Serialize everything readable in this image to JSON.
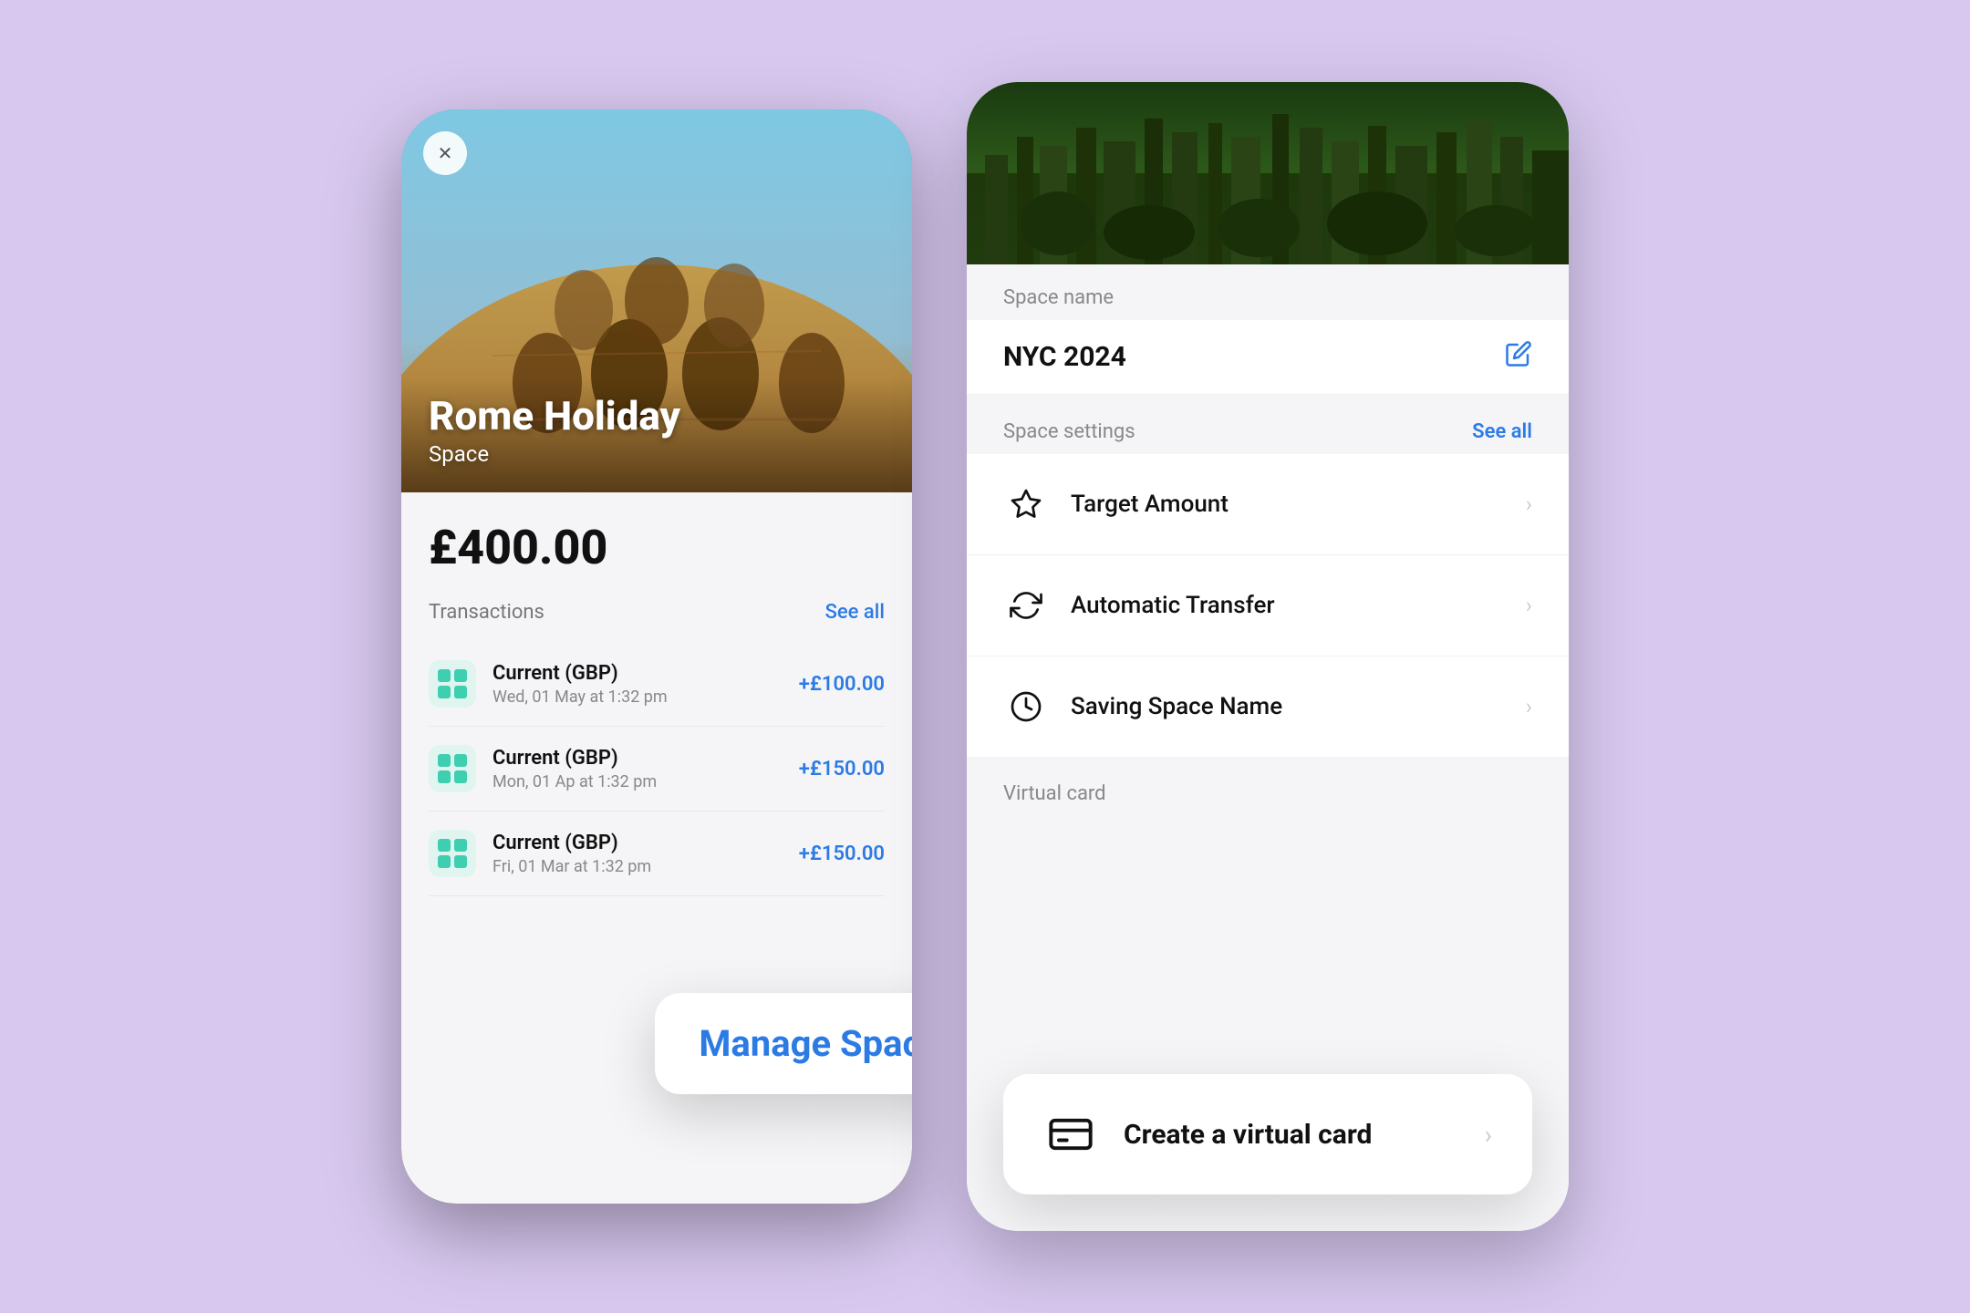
{
  "background_color": "#d8c8f0",
  "left_phone": {
    "hero": {
      "title": "Rome Holiday",
      "subtitle": "Space",
      "close_button": "×"
    },
    "balance": "£400.00",
    "transactions_label": "Transactions",
    "see_all_label": "See all",
    "transactions": [
      {
        "name": "Current (GBP)",
        "date": "Wed, 01 May at 1:32 pm",
        "amount": "+£100.00"
      },
      {
        "name": "Current (GBP)",
        "date": "Mon, 01 Ap at 1:32 pm",
        "amount": "+£150.00"
      },
      {
        "name": "Current (GBP)",
        "date": "Fri, 01 Mar at 1:32 pm",
        "amount": "+£150.00"
      }
    ],
    "manage_space_label": "Manage Space"
  },
  "right_panel": {
    "space_name_label": "Space name",
    "space_name_value": "NYC 2024",
    "settings_label": "Space settings",
    "settings_see_all": "See all",
    "settings_items": [
      {
        "icon": "star",
        "label": "Target Amount"
      },
      {
        "icon": "refresh",
        "label": "Automatic Transfer"
      },
      {
        "icon": "tag",
        "label": "Saving Space Name"
      }
    ],
    "virtual_card_label": "Virtual card",
    "virtual_card_text": "Create a virtual card"
  }
}
